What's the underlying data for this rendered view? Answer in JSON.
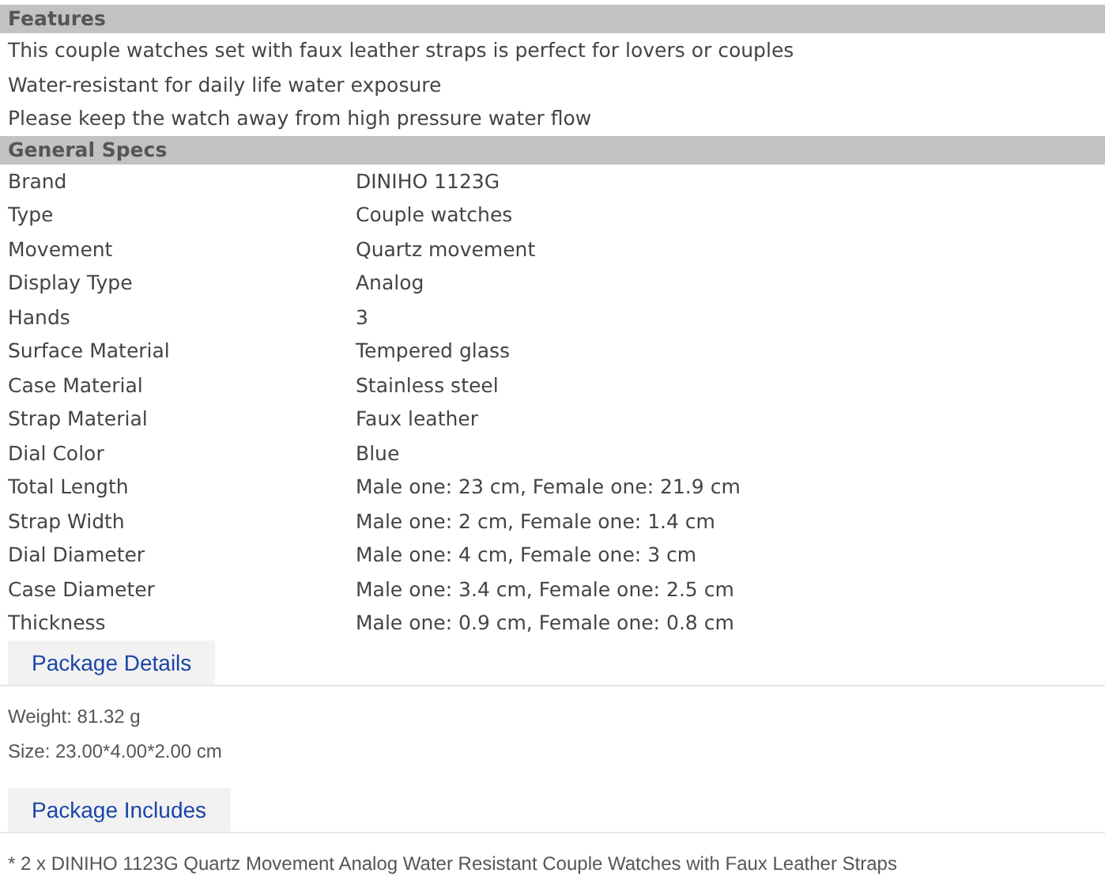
{
  "features": {
    "title": "Features",
    "lines": [
      "This couple watches set with faux leather straps is perfect for lovers or couples",
      "Water-resistant for daily life water exposure",
      "Please keep the watch away from high pressure water flow"
    ]
  },
  "general_specs": {
    "title": "General Specs",
    "rows": [
      {
        "label": "Brand",
        "value": "DINIHO 1123G"
      },
      {
        "label": "Type",
        "value": "Couple watches"
      },
      {
        "label": "Movement",
        "value": "Quartz movement"
      },
      {
        "label": "Display Type",
        "value": "Analog"
      },
      {
        "label": "Hands",
        "value": "3"
      },
      {
        "label": "Surface Material",
        "value": "Tempered glass"
      },
      {
        "label": "Case Material",
        "value": "Stainless steel"
      },
      {
        "label": "Strap Material",
        "value": "Faux leather"
      },
      {
        "label": "Dial Color",
        "value": "Blue"
      },
      {
        "label": "Total Length",
        "value": "Male one: 23 cm, Female one: 21.9 cm"
      },
      {
        "label": "Strap Width",
        "value": "Male one: 2 cm, Female one: 1.4 cm"
      },
      {
        "label": "Dial Diameter",
        "value": "Male one: 4 cm, Female one: 3 cm"
      },
      {
        "label": "Case Diameter",
        "value": "Male one: 3.4 cm, Female one: 2.5 cm"
      },
      {
        "label": "Thickness",
        "value": "Male one: 0.9 cm, Female one: 0.8 cm"
      }
    ]
  },
  "package_details": {
    "tab": "Package Details",
    "lines": [
      "Weight: 81.32 g",
      "Size: 23.00*4.00*2.00 cm"
    ]
  },
  "package_includes": {
    "tab": "Package Includes",
    "lines": [
      "* 2 x DINIHO 1123G Quartz Movement Analog Water Resistant Couple Watches with Faux Leather Straps"
    ]
  }
}
